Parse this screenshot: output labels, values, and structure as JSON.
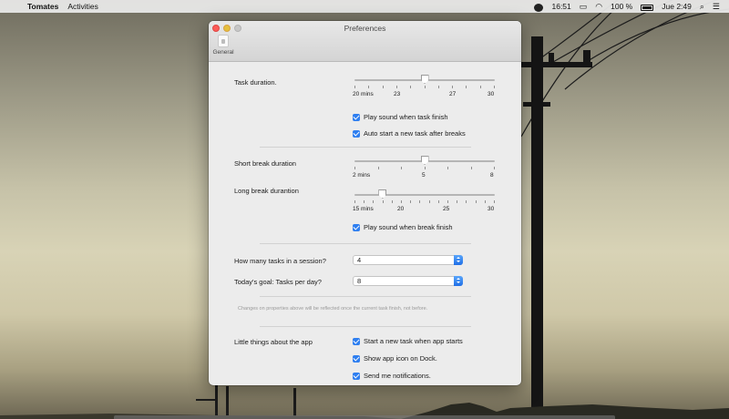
{
  "menubar": {
    "apple_glyph": "",
    "app_name": "Tomates",
    "menu_activities": "Activities",
    "clock_short": "16:51",
    "battery_text": "100 %",
    "date_time": "Jue 2:49",
    "icons": [
      "tomato-icon",
      "display-icon",
      "wifi-icon",
      "battery-icon",
      "search-icon",
      "list-icon"
    ]
  },
  "window": {
    "title": "Preferences",
    "toolbar_tab": "General"
  },
  "task_duration": {
    "label": "Task duration.",
    "value": 25,
    "min": 20,
    "max": 30,
    "tick_labels": [
      "20 mins",
      "23",
      "27",
      "30"
    ]
  },
  "task_checks": {
    "play_sound": "Play sound when task finish",
    "auto_start": "Auto start a new task after breaks"
  },
  "short_break": {
    "label": "Short break duration",
    "value": 5,
    "min": 2,
    "max": 8,
    "tick_labels": [
      "2 mins",
      "5",
      "8"
    ]
  },
  "long_break": {
    "label": "Long break durantion",
    "value": 18,
    "min": 15,
    "max": 30,
    "tick_labels": [
      "15 mins",
      "20",
      "25",
      "30"
    ]
  },
  "break_checks": {
    "play_sound": "Play sound when break finish"
  },
  "session": {
    "tasks_label": "How many tasks in a session?",
    "tasks_value": "4",
    "goal_label": "Today's goal: Tasks per day?",
    "goal_value": "8"
  },
  "note": "Changes on properties above will be reflected once the current task finish, not before.",
  "little_things": {
    "label": "Little things about the app",
    "start_task": "Start a new task when app starts",
    "show_dock": "Show app icon on Dock.",
    "notifications": "Send me notifications."
  },
  "colors": {
    "accent": "#2f7ff0",
    "close": "#fc5b57",
    "minimize": "#e5bf3c"
  }
}
